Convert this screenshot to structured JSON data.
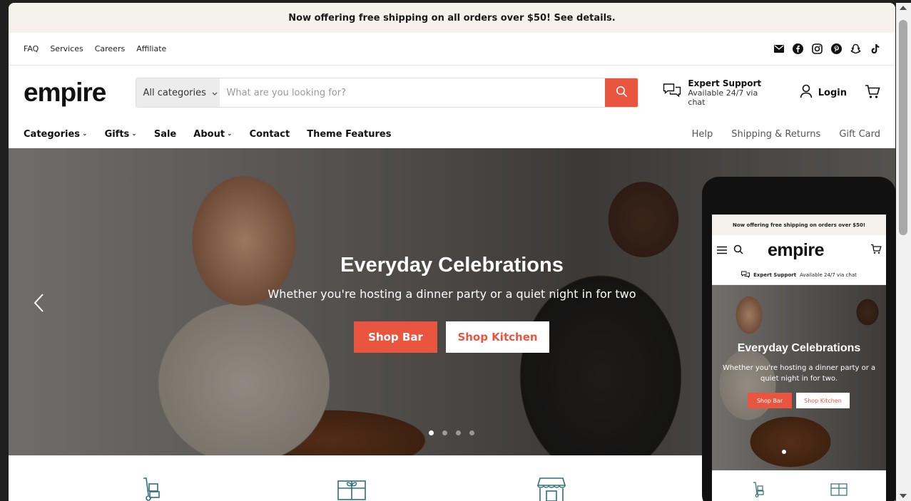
{
  "announcement": "Now offering free shipping on all orders over $50! See details.",
  "utility_links": [
    "FAQ",
    "Services",
    "Careers",
    "Affiliate"
  ],
  "social_icons": [
    "email-icon",
    "facebook-icon",
    "instagram-icon",
    "pinterest-icon",
    "snapchat-icon",
    "tiktok-icon"
  ],
  "logo": "empire",
  "search": {
    "category": "All categories",
    "placeholder": "What are you looking for?"
  },
  "support": {
    "title": "Expert Support",
    "subtitle": "Available 24/7 via chat"
  },
  "login_label": "Login",
  "nav_left": [
    {
      "label": "Categories",
      "caret": true
    },
    {
      "label": "Gifts",
      "caret": true
    },
    {
      "label": "Sale",
      "caret": false
    },
    {
      "label": "About",
      "caret": true
    },
    {
      "label": "Contact",
      "caret": false
    },
    {
      "label": "Theme Features",
      "caret": false
    }
  ],
  "nav_right": [
    "Help",
    "Shipping & Returns",
    "Gift Card"
  ],
  "hero": {
    "title": "Everyday Celebrations",
    "subtitle": "Whether you're hosting a dinner party or a quiet night in for two",
    "button_primary": "Shop Bar",
    "button_secondary": "Shop Kitchen",
    "slide_count": 4,
    "active_slide": 1
  },
  "mobile": {
    "announcement": "Now offering free shipping on orders over $50!",
    "logo": "empire",
    "support_title": "Expert Support",
    "support_subtitle": "Available 24/7 via chat",
    "hero_title": "Everyday Celebrations",
    "hero_subtitle": "Whether you're hosting a dinner party or a quiet night in for two.",
    "button_primary": "Shop Bar",
    "button_secondary": "Shop Kitchen"
  },
  "colors": {
    "accent": "#e9553f",
    "announcement_bg": "#f5f2ec",
    "feature_icon": "#2f6f7a"
  }
}
